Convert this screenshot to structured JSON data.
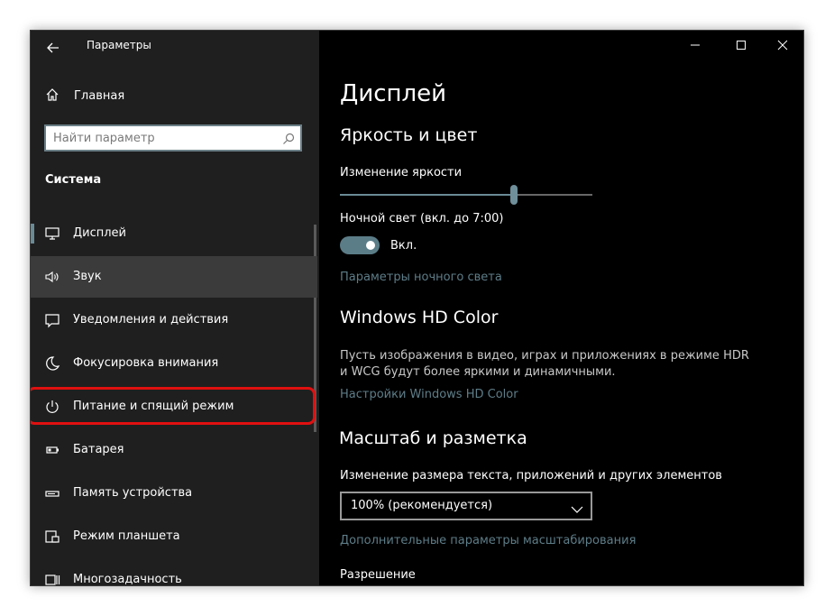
{
  "window": {
    "title": "Параметры",
    "controls": [
      "minimize-icon",
      "maximize-icon",
      "close-icon"
    ]
  },
  "sidebar": {
    "home_label": "Главная",
    "search_placeholder": "Найти параметр",
    "section_title": "Система",
    "items": [
      {
        "label": "Дисплей",
        "icon": "monitor-icon",
        "active": true
      },
      {
        "label": "Звук",
        "icon": "speaker-icon"
      },
      {
        "label": "Уведомления и действия",
        "icon": "notification-icon"
      },
      {
        "label": "Фокусировка внимания",
        "icon": "moon-icon"
      },
      {
        "label": "Питание и спящий режим",
        "icon": "power-icon",
        "highlighted": true
      },
      {
        "label": "Батарея",
        "icon": "battery-icon"
      },
      {
        "label": "Память устройства",
        "icon": "storage-icon"
      },
      {
        "label": "Режим планшета",
        "icon": "tablet-mode-icon"
      },
      {
        "label": "Многозадачность",
        "icon": "multitasking-icon"
      }
    ]
  },
  "main": {
    "page_title": "Дисплей",
    "brightness": {
      "heading": "Яркость и цвет",
      "slider_label": "Изменение яркости",
      "slider_value": 0.69,
      "night_light_label": "Ночной свет (вкл. до 7:00)",
      "toggle_state": "Вкл.",
      "night_light_link": "Параметры ночного света"
    },
    "hdr": {
      "heading": "Windows HD Color",
      "description": "Пусть изображения в видео, играх и приложениях в режиме HDR и WCG будут более яркими и динамичными.",
      "link": "Настройки Windows HD Color"
    },
    "scale": {
      "heading": "Масштаб и разметка",
      "label": "Изменение размера текста, приложений и других элементов",
      "dropdown_value": "100% (рекомендуется)",
      "link": "Дополнительные параметры масштабирования"
    },
    "resolution_label": "Разрешение"
  },
  "colors": {
    "accent": "#6a8b96",
    "highlight_border": "#e01010",
    "sidebar_bg": "#1f1f1f",
    "main_bg": "#000000"
  }
}
